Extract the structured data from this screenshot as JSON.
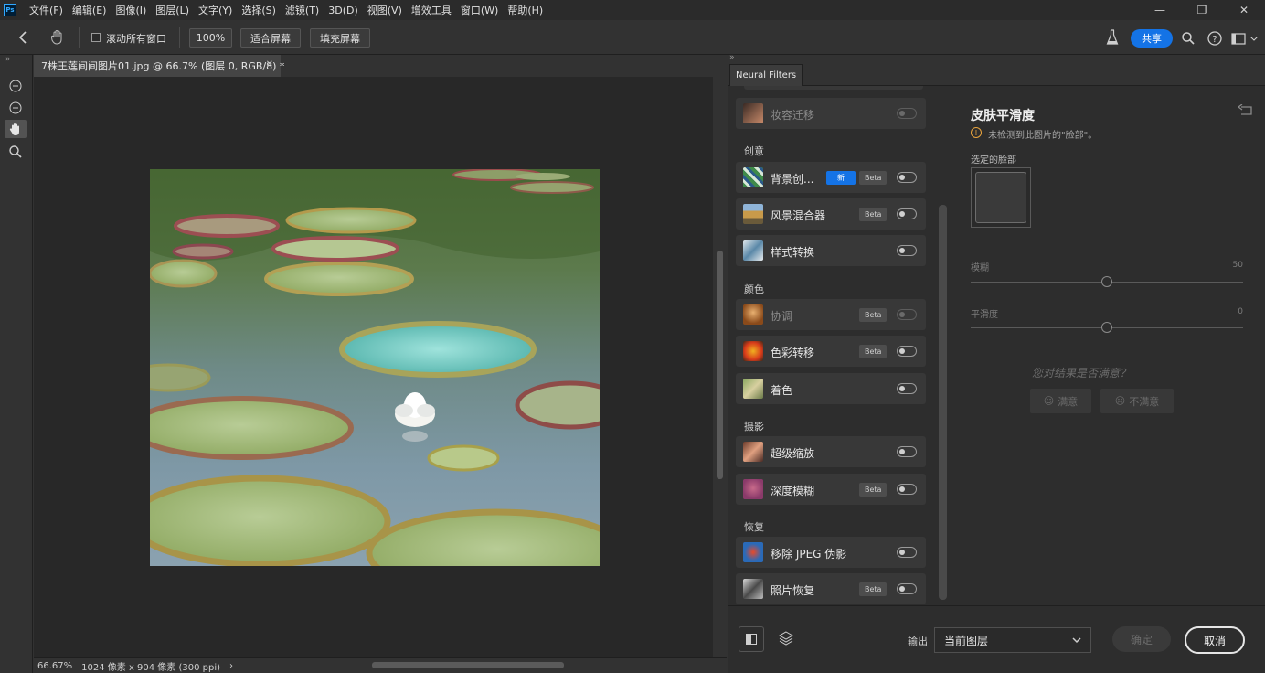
{
  "menubar": {
    "logo": "Ps",
    "items": [
      "文件(F)",
      "编辑(E)",
      "图像(I)",
      "图层(L)",
      "文字(Y)",
      "选择(S)",
      "滤镜(T)",
      "3D(D)",
      "视图(V)",
      "增效工具",
      "窗口(W)",
      "帮助(H)"
    ],
    "window_controls": [
      "—",
      "❐",
      "✕"
    ]
  },
  "optbar": {
    "scroll_all_label": "滚动所有窗口",
    "zoom_100": "100%",
    "fit_screen": "适合屏幕",
    "fill_screen": "填充屏幕",
    "share": "共享"
  },
  "document": {
    "tab_title": "7株王莲间间图片01.jpg @ 66.7% (图层 0, RGB/8) *",
    "zoom": "66.67%",
    "info": "1024 像素 x 904 像素 (300 ppi)",
    "status_arrow": "›"
  },
  "neural_filters": {
    "tab_label": "Neural Filters",
    "list": {
      "sections": [
        {
          "label": "创意"
        },
        {
          "label": "颜色"
        },
        {
          "label": "摄影"
        },
        {
          "label": "恢复"
        }
      ],
      "filters": [
        {
          "name": "妆容迁移",
          "beta": "",
          "new": ""
        },
        {
          "name": "背景创...",
          "beta": "Beta",
          "new": "新"
        },
        {
          "name": "风景混合器",
          "beta": "Beta",
          "new": ""
        },
        {
          "name": "样式转换",
          "beta": "",
          "new": ""
        },
        {
          "name": "协调",
          "beta": "Beta",
          "new": ""
        },
        {
          "name": "色彩转移",
          "beta": "Beta",
          "new": ""
        },
        {
          "name": "着色",
          "beta": "",
          "new": ""
        },
        {
          "name": "超级缩放",
          "beta": "",
          "new": ""
        },
        {
          "name": "深度模糊",
          "beta": "Beta",
          "new": ""
        },
        {
          "name": "移除 JPEG 伪影",
          "beta": "",
          "new": ""
        },
        {
          "name": "照片恢复",
          "beta": "Beta",
          "new": ""
        }
      ]
    },
    "props": {
      "title": "皮肤平滑度",
      "warning": "未检测到此图片的\"脸部\"。",
      "face_label": "选定的脸部",
      "sliders": [
        {
          "label": "模糊",
          "value": "50",
          "fraction": 0.5
        },
        {
          "label": "平滑度",
          "value": "0",
          "fraction": 0.5
        }
      ],
      "feedback_question": "您对结果是否满意？",
      "satisfied": "满意",
      "not_satisfied": "不满意"
    },
    "footer": {
      "output_label": "输出",
      "output_value": "当前图层",
      "ok": "确定",
      "cancel": "取消"
    }
  }
}
